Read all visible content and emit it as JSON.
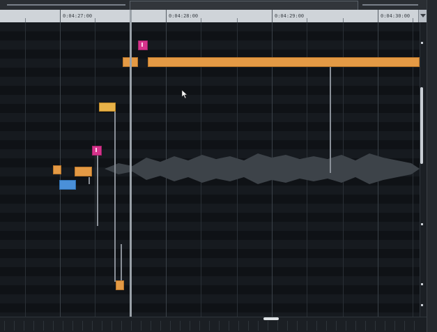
{
  "ruler": {
    "labels": [
      "0:04:27:00",
      "0:04:28:00",
      "0:04:29:00",
      "0:04:30:00"
    ]
  },
  "clips": {
    "main_label": "",
    "end_label": ""
  },
  "colors": {
    "clip_orange": "#e49a45",
    "clip_blue": "#4a90d9",
    "clip_gold": "#e8b248",
    "marker_magenta": "#d6338c",
    "background": "#111418",
    "ruler": "#cfd4d9",
    "waveform": "#3d4349"
  },
  "icons": {
    "marker_flag": "flag-marker-icon",
    "scroll_arrow": "chevron-down-icon",
    "cursor": "mouse-pointer-icon"
  }
}
